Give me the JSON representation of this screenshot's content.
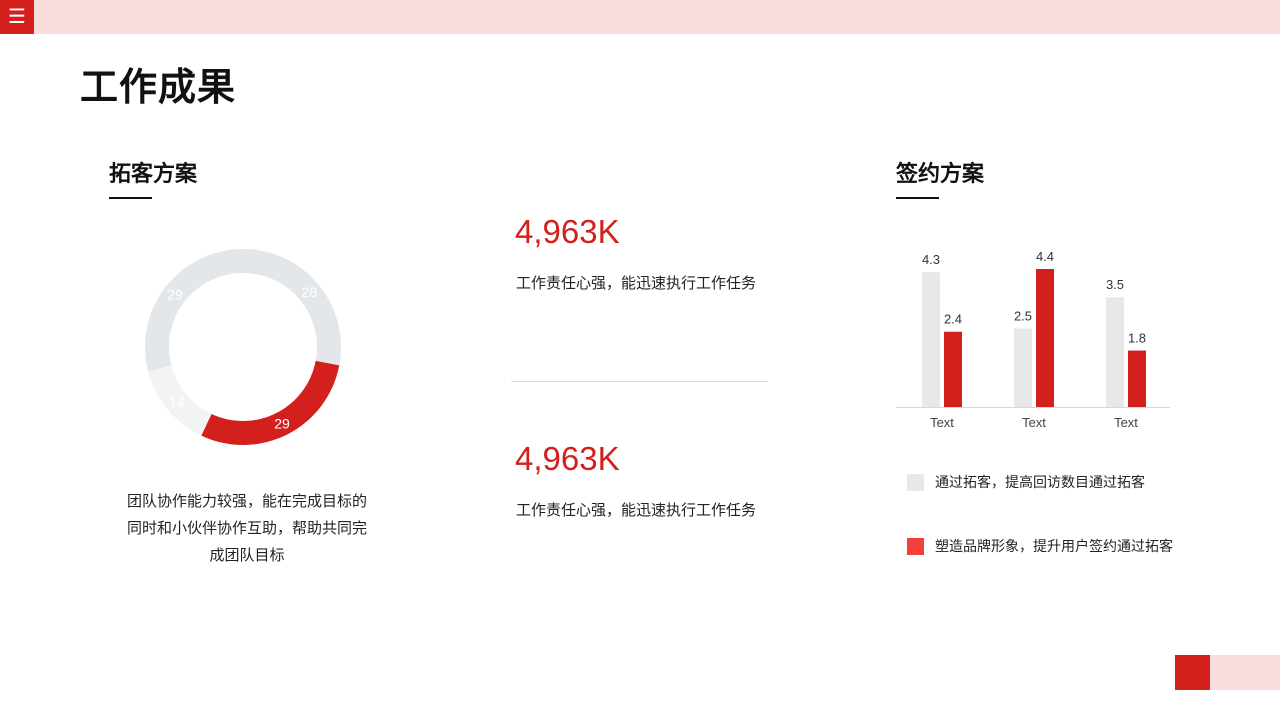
{
  "header": {
    "menu_icon": "menu-icon",
    "menu_glyph": "☰"
  },
  "title": "工作成果",
  "left": {
    "title": "拓客方案",
    "description": "团队协作能力较强，能在完成目标的同时和小伙伴协作互助，帮助共同完成团队目标"
  },
  "middle": {
    "stats": [
      {
        "value": "4,963K",
        "desc": "工作责任心强，能迅速执行工作任务"
      },
      {
        "value": "4,963K",
        "desc": "工作责任心强，能迅速执行工作任务"
      }
    ]
  },
  "right": {
    "title": "签约方案",
    "legend": [
      {
        "label": "通过拓客，提高回访数目通过拓客",
        "color": "#e8e8e8"
      },
      {
        "label": "塑造品牌形象，提升用户签约通过拓客",
        "color": "#f2403a"
      }
    ]
  },
  "colors": {
    "accent": "#d3201c",
    "light": "#e4e7ea",
    "pale": "#f2f3f3",
    "bar_gray": "#e8e8e8"
  },
  "chart_data": [
    {
      "type": "pie",
      "values": [
        28,
        29,
        14,
        29
      ],
      "labels": [
        "28",
        "29",
        "14",
        "29"
      ],
      "colors": [
        "#e4e7ea",
        "#d3201c",
        "#f2f3f3",
        "#e4e7ea"
      ]
    },
    {
      "type": "bar",
      "categories": [
        "Text",
        "Text",
        "Text"
      ],
      "series": [
        {
          "values": [
            4.3,
            2.5,
            3.5
          ],
          "color": "#e8e8e8"
        },
        {
          "values": [
            2.4,
            4.4,
            1.8
          ],
          "color": "#d3201c"
        }
      ],
      "ylim": [
        0,
        4.4
      ]
    }
  ]
}
